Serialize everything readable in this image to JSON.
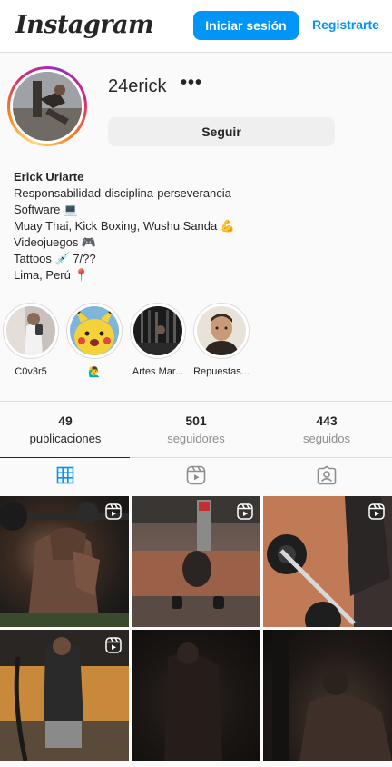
{
  "header": {
    "logo": "Instagram",
    "login_label": "Iniciar sesión",
    "register_label": "Registrarte"
  },
  "profile": {
    "username": "24erick",
    "more_label": "•••",
    "follow_label": "Seguir"
  },
  "bio": {
    "name": "Erick Uriarte",
    "lines": [
      "Responsabilidad-disciplina-perseverancia",
      "Software 💻",
      "Muay Thai, Kick Boxing, Wushu Sanda 💪",
      "Videojuegos 🎮",
      "Tattoos 💉 7/??",
      "Lima, Perú 📍"
    ]
  },
  "highlights": [
    {
      "label": "C0v3r5"
    },
    {
      "label": "🙋‍♂️"
    },
    {
      "label": "Artes Mar..."
    },
    {
      "label": "Repuestas..."
    }
  ],
  "stats": [
    {
      "value": "49",
      "label": "publicaciones"
    },
    {
      "value": "501",
      "label": "seguidores"
    },
    {
      "value": "443",
      "label": "seguidos"
    }
  ],
  "tabs": [
    {
      "icon": "grid-icon",
      "active": true
    },
    {
      "icon": "reels-icon",
      "active": false
    },
    {
      "icon": "tagged-icon",
      "active": false
    }
  ],
  "posts": [
    {
      "type": "reel"
    },
    {
      "type": "reel"
    },
    {
      "type": "reel"
    },
    {
      "type": "reel"
    },
    {
      "type": "photo"
    },
    {
      "type": "photo"
    }
  ],
  "colors": {
    "accent": "#0095f6",
    "text": "#262626",
    "muted": "#8e8e8e",
    "border": "#dbdbdb"
  }
}
